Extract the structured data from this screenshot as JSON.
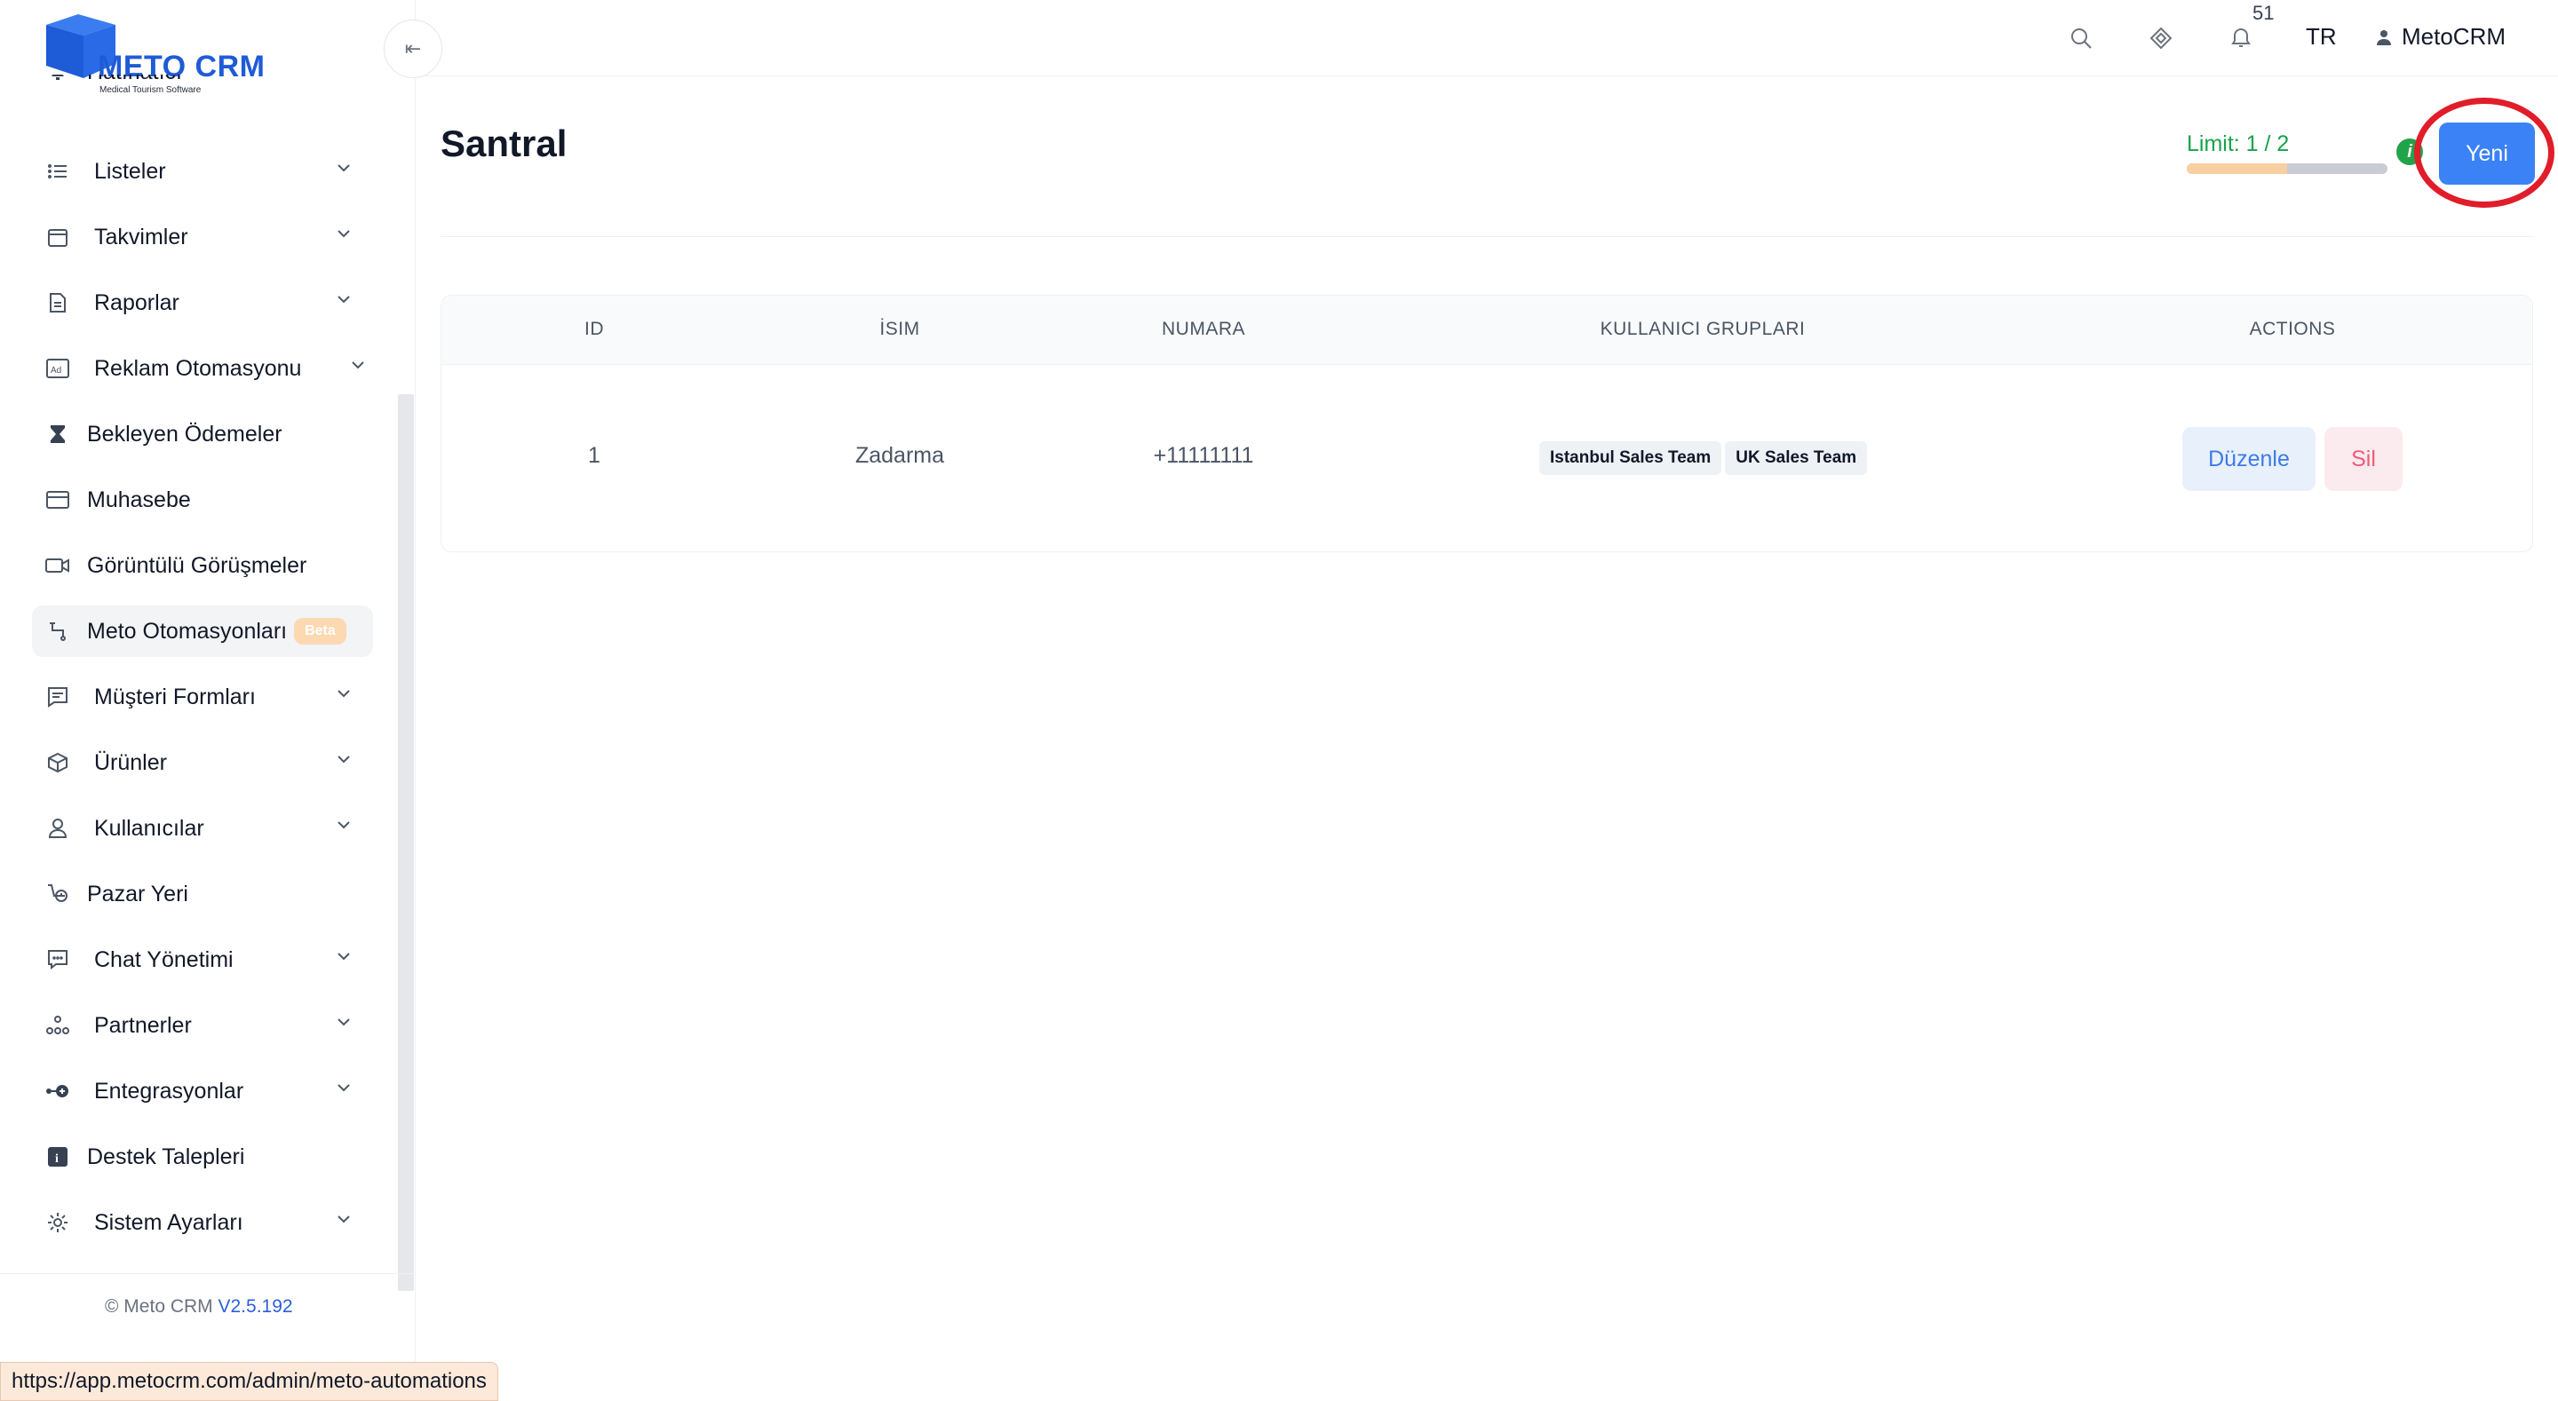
{
  "brand": {
    "name": "METO CRM",
    "tagline": "Medical Tourism Software",
    "color": "#1e5bd7"
  },
  "sidebar": {
    "items": [
      {
        "label": "Hatırlatıcı",
        "icon": "bell-icon",
        "expandable": false
      },
      {
        "label": "Listeler",
        "icon": "list-icon",
        "expandable": true
      },
      {
        "label": "Takvimler",
        "icon": "calendar-icon",
        "expandable": true
      },
      {
        "label": "Raporlar",
        "icon": "document-icon",
        "expandable": true
      },
      {
        "label": "Reklam Otomasyonu",
        "icon": "ad-icon",
        "expandable": true
      },
      {
        "label": "Bekleyen Ödemeler",
        "icon": "hourglass-icon",
        "expandable": false
      },
      {
        "label": "Muhasebe",
        "icon": "credit-card-icon",
        "expandable": false
      },
      {
        "label": "Görüntülü Görüşmeler",
        "icon": "video-icon",
        "expandable": false
      },
      {
        "label": "Meto Otomasyonları",
        "icon": "flow-icon",
        "expandable": false,
        "badge": "Beta",
        "active": true
      },
      {
        "label": "Müşteri Formları",
        "icon": "form-icon",
        "expandable": true
      },
      {
        "label": "Ürünler",
        "icon": "box-icon",
        "expandable": true
      },
      {
        "label": "Kullanıcılar",
        "icon": "user-icon",
        "expandable": true
      },
      {
        "label": "Pazar Yeri",
        "icon": "marketplace-icon",
        "expandable": false
      },
      {
        "label": "Chat Yönetimi",
        "icon": "chat-icon",
        "expandable": true
      },
      {
        "label": "Partnerler",
        "icon": "partners-icon",
        "expandable": true
      },
      {
        "label": "Entegrasyonlar",
        "icon": "integration-icon",
        "expandable": true
      },
      {
        "label": "Destek Talepleri",
        "icon": "info-icon",
        "expandable": false
      },
      {
        "label": "Sistem Ayarları",
        "icon": "settings-icon",
        "expandable": true
      }
    ],
    "footer": {
      "copyright": "© Meto CRM",
      "version": "V2.5.192"
    },
    "status_url": "https://app.metocrm.com/admin/meto-automations"
  },
  "topbar": {
    "notification_count": "51",
    "language": "TR",
    "username": "MetoCRM"
  },
  "page": {
    "title": "Santral",
    "limit_label": "Limit: 1 / 2",
    "limit_fraction": 0.5,
    "new_button": "Yeni",
    "highlight_color": "#e11d2a"
  },
  "table": {
    "headers": [
      "ID",
      "İSIM",
      "NUMARA",
      "KULLANICI GRUPLARI",
      "ACTIONS"
    ],
    "rows": [
      {
        "id": "1",
        "name": "Zadarma",
        "number": "+11111111",
        "groups": [
          "Istanbul Sales Team",
          "UK Sales Team"
        ],
        "edit": "Düzenle",
        "delete": "Sil"
      }
    ]
  }
}
